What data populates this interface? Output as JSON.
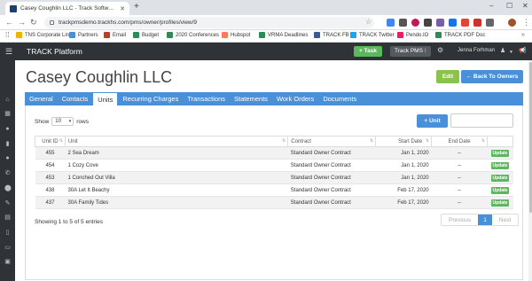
{
  "browser": {
    "tab_title": "Casey Coughlin LLC - Track Softw…",
    "url": "trackpmsdemo.trackhs.com/pms/owner/profiles/view/9",
    "bookmarks": [
      "TNS Corporate Links",
      "Partners",
      "Email",
      "Budget",
      "2020 Conferences",
      "Hubspot",
      "VRMA Deadlines",
      "TRACK FB",
      "TRACK Twitter",
      "Pendo.IO",
      "TRACK PDF Doc"
    ],
    "bookmark_colors": [
      "#f0b400",
      "#4a90d9",
      "#c23b22",
      "#2e8b57",
      "#2e8b57",
      "#ff7a59",
      "#2e8b57",
      "#3b5998",
      "#1da1f2",
      "#e91e63",
      "#2e8b57"
    ]
  },
  "app": {
    "brand": "TRACK Platform",
    "task_button": "+ Task",
    "pms_button": "Track PMS ⁝",
    "user_name": "Jenna Forhman"
  },
  "page": {
    "title": "Casey Coughlin LLC",
    "edit_button": "Edit",
    "back_button": "← Back To Owners",
    "tabs": [
      "General",
      "Contacts",
      "Units",
      "Recurring Charges",
      "Transactions",
      "Statements",
      "Work Orders",
      "Documents"
    ],
    "active_tab": "Units"
  },
  "units": {
    "show_label": "Show",
    "rows_label": "rows",
    "page_size": "10",
    "add_button": "+ Unit",
    "columns": [
      "Unit ID",
      "Unit",
      "Contract",
      "Start Date",
      "End Date",
      ""
    ],
    "rows": [
      {
        "id": "455",
        "unit": "2 Sea Dream",
        "contract": "Standard Owner Contract",
        "start": "Jan 1, 2020",
        "end": "--",
        "action": "Update"
      },
      {
        "id": "454",
        "unit": "1 Cozy Cove",
        "contract": "Standard Owner Contract",
        "start": "Jan 1, 2020",
        "end": "--",
        "action": "Update"
      },
      {
        "id": "453",
        "unit": "1 Conched Out Villa",
        "contract": "Standard Owner Contract",
        "start": "Jan 1, 2020",
        "end": "--",
        "action": "Update"
      },
      {
        "id": "438",
        "unit": "30A Let It Beachy",
        "contract": "Standard Owner Contract",
        "start": "Feb 17, 2020",
        "end": "--",
        "action": "Update"
      },
      {
        "id": "437",
        "unit": "30A Family Tides",
        "contract": "Standard Owner Contract",
        "start": "Feb 17, 2020",
        "end": "--",
        "action": "Update"
      }
    ],
    "info": "Showing 1 to 5 of 5 entries",
    "prev": "Previous",
    "current_page": "1",
    "next": "Next"
  },
  "colors": {
    "primary": "#4a90d9",
    "success": "#5cb85c",
    "dark": "#2f3337"
  }
}
